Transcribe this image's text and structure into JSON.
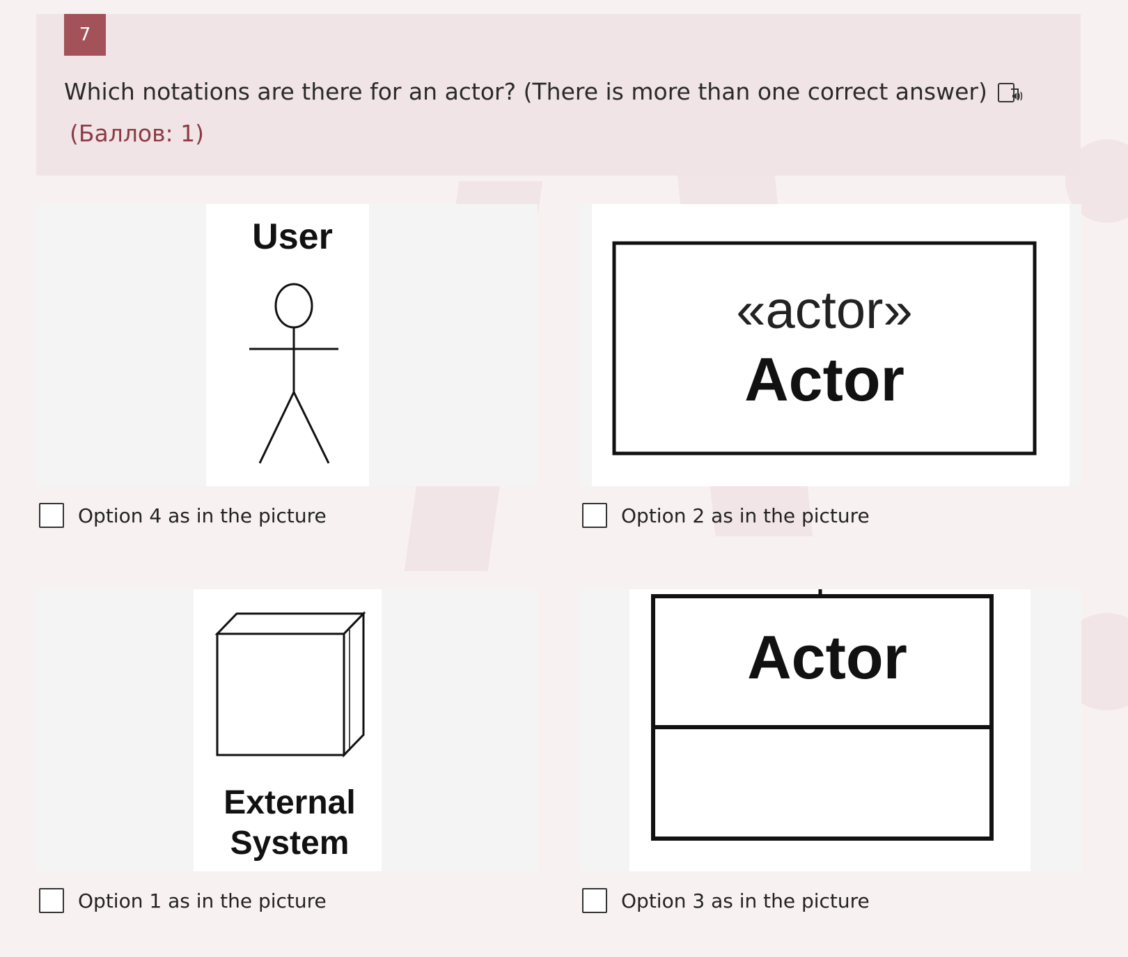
{
  "question": {
    "number": "7",
    "text": "Which notations are there for an actor? (There is more than one correct answer)",
    "points": "(Баллов: 1)",
    "speaker_icon": "text-to-speech-icon"
  },
  "options": [
    {
      "label": "Option 4 as in the picture",
      "picture": {
        "text": "User",
        "figure": "stick-figure"
      }
    },
    {
      "label": "Option 2 as in the picture",
      "picture": {
        "stereotype": "«actor»",
        "text": "Actor",
        "figure": "class-box"
      }
    },
    {
      "label": "Option 1 as in the picture",
      "picture": {
        "line1": "External",
        "line2": "System",
        "figure": "node-cube"
      }
    },
    {
      "label": "Option 3 as in the picture",
      "picture": {
        "text": "Actor",
        "figure": "class-box-with-compartment"
      }
    }
  ],
  "colors": {
    "accent": "#a3525a",
    "points_text": "#8c3b43",
    "question_bg": "#f0e4e6",
    "page_bg": "#f8f1f2"
  }
}
